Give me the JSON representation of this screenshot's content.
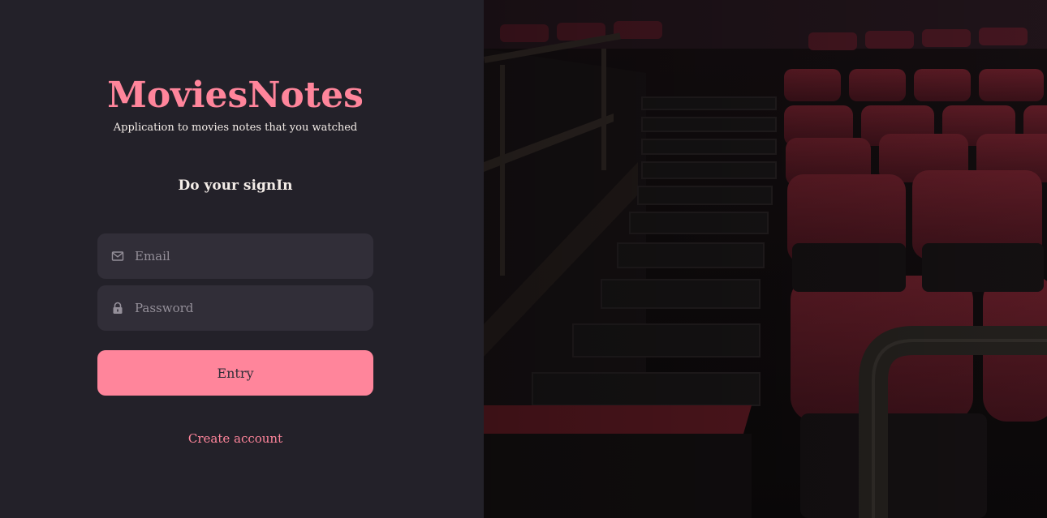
{
  "brand": {
    "title": "MoviesNotes",
    "subtitle": "Application to movies notes that you watched"
  },
  "form": {
    "heading": "Do your signIn",
    "email": {
      "placeholder": "Email",
      "value": "",
      "icon": "mail-icon"
    },
    "password": {
      "placeholder": "Password",
      "value": "",
      "icon": "lock-icon"
    },
    "submit_label": "Entry",
    "create_account_label": "Create account"
  },
  "colors": {
    "background": "#232129",
    "input_background": "#312e38",
    "accent": "#ff859b",
    "text": "#f4ede8",
    "placeholder": "#948f99"
  },
  "background_image": {
    "subject": "movie theater auditorium stairs with red seats"
  }
}
